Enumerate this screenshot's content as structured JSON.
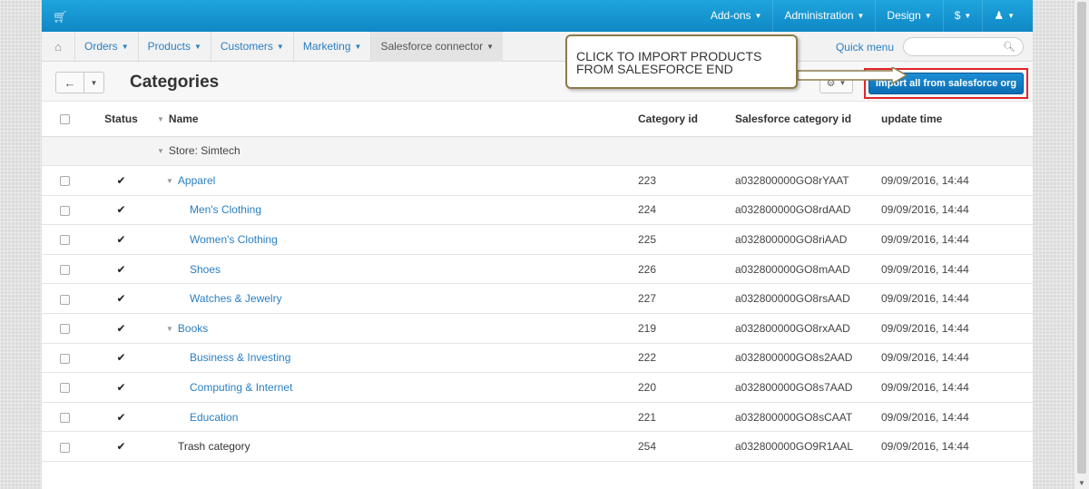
{
  "topbar": {
    "logo_icon": "cart-icon",
    "items": [
      {
        "label": "Add-ons"
      },
      {
        "label": "Administration"
      },
      {
        "label": "Design"
      },
      {
        "label": "$"
      },
      {
        "label": ""
      }
    ]
  },
  "subnav": {
    "items": [
      {
        "label": "Orders"
      },
      {
        "label": "Products"
      },
      {
        "label": "Customers"
      },
      {
        "label": "Marketing"
      },
      {
        "label": "Salesforce connector"
      }
    ],
    "quick_menu": "Quick menu",
    "search_placeholder": ""
  },
  "header": {
    "title": "Categories",
    "import_button": "Import all from salesforce org"
  },
  "callout": {
    "line1": "CLICK TO IMPORT PRODUCTS",
    "line2": "FROM SALESFORCE END"
  },
  "table": {
    "columns": {
      "status": "Status",
      "name": "Name",
      "category_id": "Category id",
      "sf_id": "Salesforce category id",
      "update_time": "update time"
    },
    "store_row": "Store: Simtech",
    "rows": [
      {
        "name": "Apparel",
        "id": "223",
        "sfid": "a032800000GO8rYAAT",
        "time": "09/09/2016, 14:44"
      },
      {
        "name": "Men's Clothing",
        "id": "224",
        "sfid": "a032800000GO8rdAAD",
        "time": "09/09/2016, 14:44"
      },
      {
        "name": "Women's Clothing",
        "id": "225",
        "sfid": "a032800000GO8riAAD",
        "time": "09/09/2016, 14:44"
      },
      {
        "name": "Shoes",
        "id": "226",
        "sfid": "a032800000GO8mAAD",
        "time": "09/09/2016, 14:44"
      },
      {
        "name": "Watches & Jewelry",
        "id": "227",
        "sfid": "a032800000GO8rsAAD",
        "time": "09/09/2016, 14:44"
      },
      {
        "name": "Books",
        "id": "219",
        "sfid": "a032800000GO8rxAAD",
        "time": "09/09/2016, 14:44"
      },
      {
        "name": "Business & Investing",
        "id": "222",
        "sfid": "a032800000GO8s2AAD",
        "time": "09/09/2016, 14:44"
      },
      {
        "name": "Computing & Internet",
        "id": "220",
        "sfid": "a032800000GO8s7AAD",
        "time": "09/09/2016, 14:44"
      },
      {
        "name": "Education",
        "id": "221",
        "sfid": "a032800000GO8sCAAT",
        "time": "09/09/2016, 14:44"
      },
      {
        "name": "Trash category",
        "id": "254",
        "sfid": "a032800000GO9R1AAL",
        "time": "09/09/2016, 14:44"
      }
    ]
  },
  "colors": {
    "topbar": "#1a9ad6",
    "link": "#2a7fc2",
    "primary_button": "#0f7cc4",
    "highlight_border": "#e0262b"
  }
}
